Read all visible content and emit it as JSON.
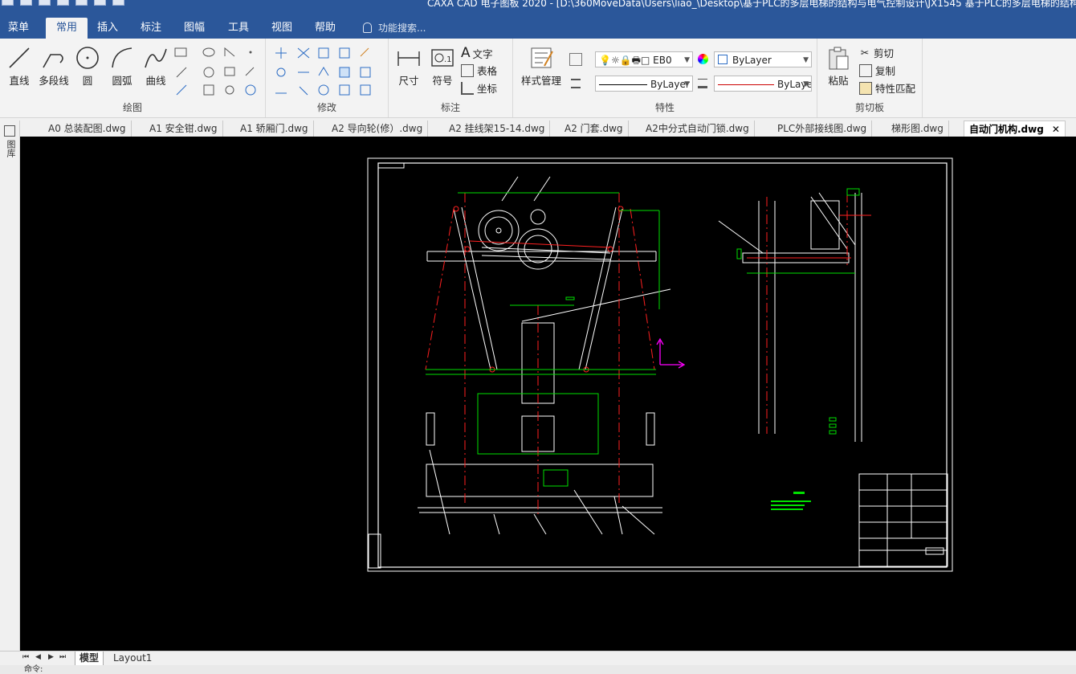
{
  "window": {
    "title": "CAXA CAD 电子图板 2020 - [D:\\360MoveData\\Users\\liao_\\Desktop\\基于PLC的多层电梯的结构与电气控制设计\\JX1545 基于PLC的多层电梯的结构与"
  },
  "menu": {
    "items": [
      "菜单",
      "常用",
      "插入",
      "标注",
      "图幅",
      "工具",
      "视图",
      "帮助"
    ],
    "active": "常用",
    "search_placeholder": "功能搜索..."
  },
  "ribbon": {
    "draw": {
      "group_label": "绘图",
      "line": "直线",
      "polyline": "多段线",
      "circle": "圆",
      "arc": "圆弧",
      "curve": "曲线"
    },
    "modify": {
      "group_label": "修改"
    },
    "annotate": {
      "group_label": "标注",
      "dimension": "尺寸",
      "symbol": "符号",
      "text": "文字",
      "table": "表格",
      "coordinate": "坐标"
    },
    "properties": {
      "group_label": "特性",
      "style_manager": "样式管理",
      "layer_value": "EB0",
      "color_value": "ByLayer",
      "linetype_value": "ByLayer",
      "lineweight_value": "ByLaye"
    },
    "clipboard": {
      "group_label": "剪切板",
      "paste": "粘贴",
      "cut": "剪切",
      "copy": "复制",
      "match": "特性匹配"
    }
  },
  "doc_tabs": [
    "A0 总装配图.dwg",
    "A1 安全钳.dwg",
    "A1 轿厢门.dwg",
    "A2 导向轮(修）.dwg",
    "A2 挂线架15-14.dwg",
    "A2 门套.dwg",
    "A2中分式自动门锁.dwg",
    "PLC外部接线图.dwg",
    "梯形图.dwg",
    "自动门机构.dwg"
  ],
  "active_doc": "自动门机构.dwg",
  "side_panel_label": "图库",
  "layout_tabs": [
    "模型",
    "Layout1"
  ],
  "active_layout": "模型",
  "status_text": "命令:",
  "colors": {
    "ribbon_blue": "#2b579a",
    "canvas_bg": "#000000",
    "drawing_white": "#ffffff",
    "green": "#00ff00",
    "red": "#ff0000",
    "magenta": "#ff00ff"
  }
}
